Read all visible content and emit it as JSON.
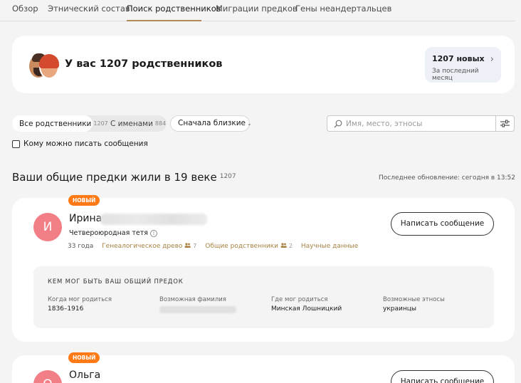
{
  "tabs": [
    {
      "label": "Обзор"
    },
    {
      "label": "Этнический состав"
    },
    {
      "label": "Поиск родственников",
      "active": true
    },
    {
      "label": "Миграции предков"
    },
    {
      "label": "Гены неандертальцев"
    }
  ],
  "summary": {
    "title": "У вас 1207 родственников",
    "new_count": "1207 новых",
    "new_period": "За последний месяц"
  },
  "filters": {
    "all_label": "Все родственники",
    "all_count": "1207",
    "named_label": "С именами",
    "named_count": "884",
    "sort_label": "Сначала близкие",
    "search_placeholder": "Имя, место, этносы",
    "can_message_label": "Кому можно писать сообщения"
  },
  "section": {
    "title": "Ваши общие предки жили в 19 веке",
    "count": "1207",
    "updated": "Последнее обновление: сегодня в 13:52"
  },
  "relatives": [
    {
      "badge": "НОВЫЙ",
      "initial": "И",
      "name": "Ирина",
      "relation": "Четвероюродная тетя",
      "age": "33 года",
      "tree_label": "Генеалогическое древо",
      "tree_count": "7",
      "common_label": "Общие родственники",
      "common_count": "2",
      "science_label": "Научные данные",
      "message_button": "Написать сообщение",
      "ancestor": {
        "title": "КЕМ МОГ БЫТЬ ВАШ ОБЩИЙ ПРЕДОК",
        "born_when_label": "Когда мог родиться",
        "born_when": "1836–1916",
        "surname_label": "Возможная фамилия",
        "born_where_label": "Где мог родиться",
        "born_where": "Минская Лошницкий",
        "ethnos_label": "Возможные этносы",
        "ethnos": "украинцы"
      }
    },
    {
      "badge": "НОВЫЙ",
      "initial": "О",
      "name": "Ольга",
      "message_button": "Написать сообщение"
    }
  ],
  "colors": {
    "accent_gold": "#b08a57",
    "badge_orange": "#ff7a14",
    "avatar_pink": "#f27e86"
  },
  "icons": [
    "search-icon",
    "filter-icon",
    "chevron-right-icon",
    "chevron-down-icon",
    "info-icon",
    "people-icon"
  ]
}
